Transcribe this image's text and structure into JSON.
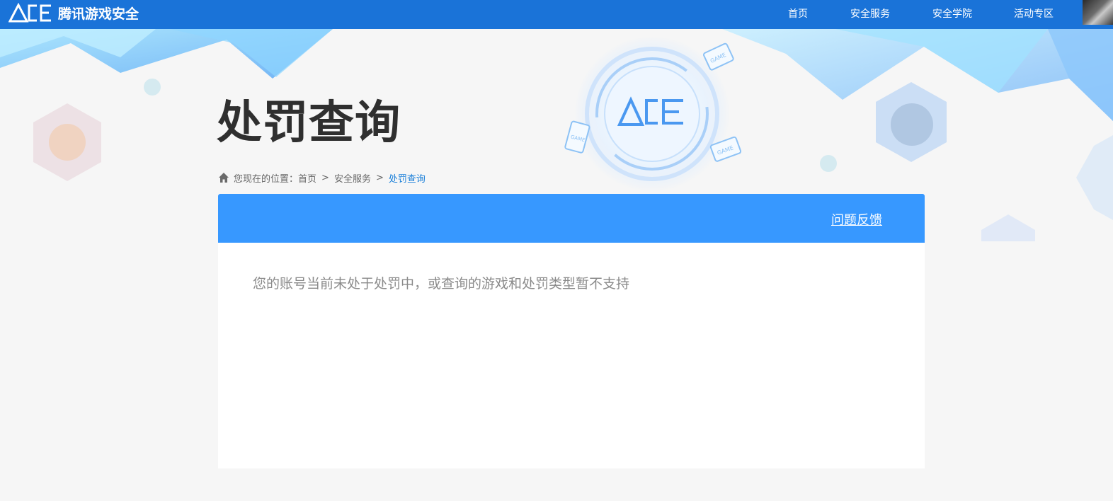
{
  "header": {
    "logo_mark": "ACE",
    "logo_text": "腾讯游戏安全",
    "nav": [
      {
        "label": "首页"
      },
      {
        "label": "安全服务"
      },
      {
        "label": "安全学院"
      },
      {
        "label": "活动专区"
      }
    ]
  },
  "page": {
    "title": "处罚查询"
  },
  "breadcrumb": {
    "prefix": "您现在的位置：",
    "items": [
      "首页",
      "安全服务",
      "处罚查询"
    ],
    "separator": ">"
  },
  "card": {
    "feedback_label": "问题反馈",
    "message": "您的账号当前未处于处罚中，或查询的游戏和处罚类型暂不支持"
  },
  "decorations": {
    "emblem_text": "ACE",
    "device_labels": [
      "GAME",
      "GAME",
      "GAME"
    ]
  },
  "colors": {
    "topbar": "#1a73d8",
    "card_header": "#3798ff",
    "breadcrumb_current": "#1a7fd8",
    "page_bg": "#f6f6f6"
  }
}
